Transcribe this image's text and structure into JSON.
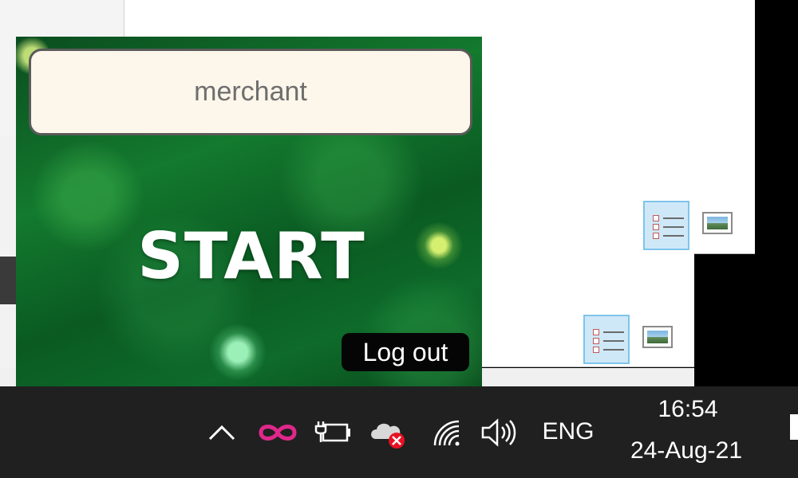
{
  "app": {
    "merchant_field": "merchant",
    "start_label": "START",
    "logout_label": "Log out"
  },
  "taskbar": {
    "tray_icons": [
      "chevron-up-icon",
      "infinity-link-icon",
      "battery-plug-icon",
      "cloud-error-icon",
      "wifi-icon",
      "volume-icon"
    ],
    "language": "ENG",
    "clock_time": "16:54",
    "clock_date": "24-Aug-21"
  },
  "colors": {
    "accent_pink": "#e0288a",
    "error_red": "#e81123",
    "field_bg": "#fdf6ea",
    "taskbar_bg": "#202020"
  }
}
